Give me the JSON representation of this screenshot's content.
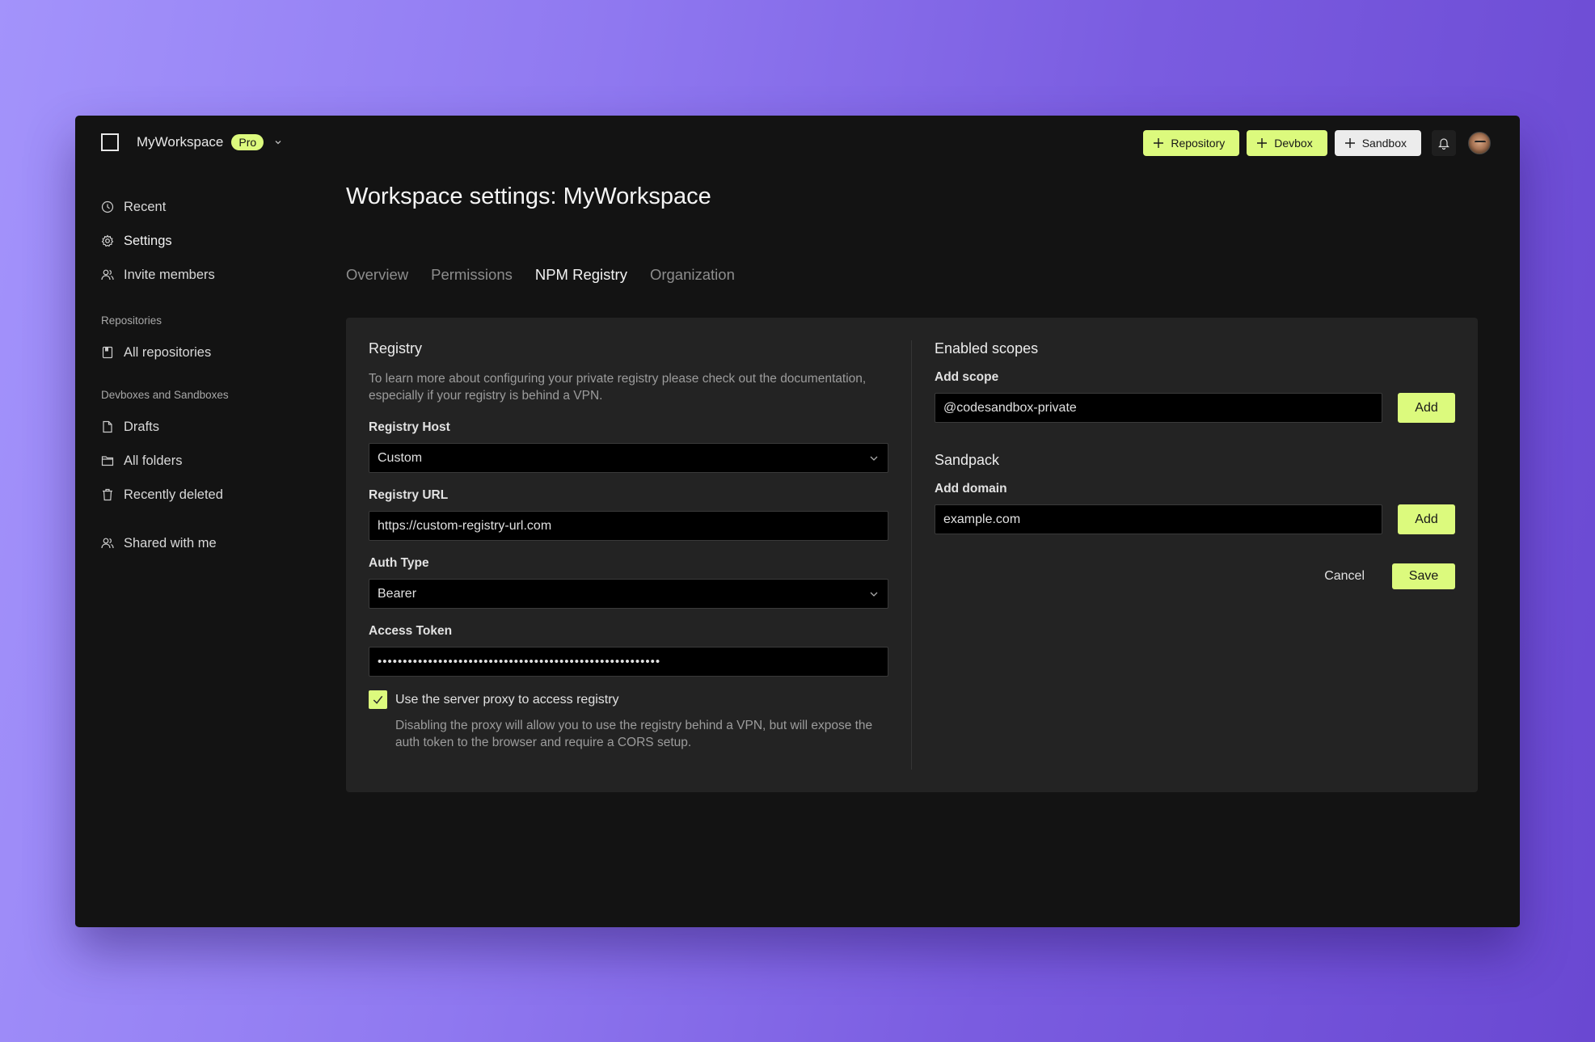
{
  "workspace": {
    "name": "MyWorkspace",
    "plan_badge": "Pro"
  },
  "topbar": {
    "buttons": [
      {
        "label": "Repository",
        "icon": "plus-icon",
        "color": "#dcfa7d"
      },
      {
        "label": "Devbox",
        "icon": "plus-icon",
        "color": "#dcfa7d"
      },
      {
        "label": "Sandbox",
        "icon": "plus-icon",
        "color": "#ececec"
      }
    ],
    "notifications_icon": "bell-icon",
    "avatar_icon": "user-avatar"
  },
  "sidebar": {
    "items": [
      {
        "label": "Recent",
        "icon": "clock-icon"
      },
      {
        "label": "Settings",
        "icon": "gear-icon",
        "active": true
      },
      {
        "label": "Invite members",
        "icon": "users-icon"
      }
    ],
    "sections": [
      {
        "title": "Repositories",
        "items": [
          {
            "label": "All repositories",
            "icon": "repository-icon"
          }
        ]
      },
      {
        "title": "Devboxes and Sandboxes",
        "items": [
          {
            "label": "Drafts",
            "icon": "file-icon"
          },
          {
            "label": "All folders",
            "icon": "folder-icon"
          },
          {
            "label": "Recently deleted",
            "icon": "trash-icon"
          }
        ]
      }
    ],
    "shared": {
      "label": "Shared with me",
      "icon": "users-icon"
    }
  },
  "main": {
    "title": "Workspace settings: MyWorkspace",
    "tabs": [
      {
        "label": "Overview"
      },
      {
        "label": "Permissions"
      },
      {
        "label": "NPM Registry",
        "active": true
      },
      {
        "label": "Organization"
      }
    ]
  },
  "registry": {
    "title": "Registry",
    "description": "To learn more about configuring your private registry please check out the documentation, especially if your registry is behind a VPN.",
    "host_label": "Registry Host",
    "host_value": "Custom",
    "url_label": "Registry URL",
    "url_value": "https://custom-registry-url.com",
    "auth_label": "Auth Type",
    "auth_value": "Bearer",
    "token_label": "Access Token",
    "token_value": "••••••••••••••••••••••••••••••••••••••••••••••••••••••••",
    "proxy_checked": true,
    "proxy_label": "Use the server proxy to access registry",
    "proxy_help": "Disabling the proxy will allow you to use the registry behind a VPN, but will expose the auth token to the browser and require a CORS setup."
  },
  "scopes": {
    "title": "Enabled scopes",
    "add_label": "Add scope",
    "add_value": "@codesandbox-private",
    "add_button": "Add"
  },
  "sandpack": {
    "title": "Sandpack",
    "add_label": "Add domain",
    "add_value": "example.com",
    "add_button": "Add"
  },
  "actions": {
    "cancel": "Cancel",
    "save": "Save"
  },
  "colors": {
    "accent": "#dcfa7d",
    "window_bg": "#131313",
    "panel_bg": "#232323",
    "input_bg": "#000000"
  }
}
